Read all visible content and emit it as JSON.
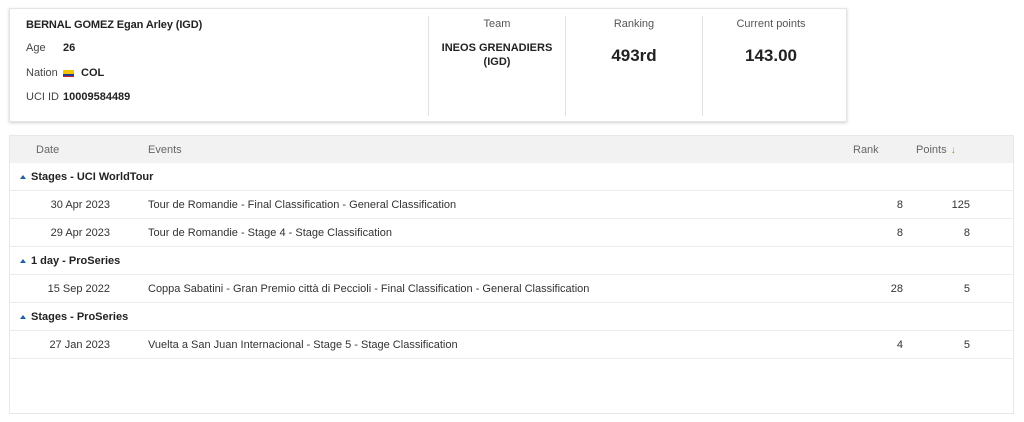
{
  "rider": {
    "name": "BERNAL GOMEZ Egan Arley (IGD)",
    "age_label": "Age",
    "age": "26",
    "nation_label": "Nation",
    "nation": "COL",
    "nation_flag_icon": "colombia-flag-icon",
    "uci_label": "UCI ID",
    "uci_id": "10009584489"
  },
  "summary": {
    "team_label": "Team",
    "team_line1": "INEOS GRENADIERS",
    "team_line2": "(IGD)",
    "ranking_label": "Ranking",
    "ranking": "493rd",
    "points_label": "Current points",
    "points": "143.00"
  },
  "table": {
    "headers": {
      "date": "Date",
      "events": "Events",
      "rank": "Rank",
      "points": "Points",
      "sort_icon": "sort-down-arrow-icon"
    },
    "groups": [
      {
        "label": "Stages - UCI WorldTour",
        "rows": [
          {
            "date": "30 Apr 2023",
            "event": "Tour de Romandie - Final Classification - General Classification",
            "rank": "8",
            "points": "125"
          },
          {
            "date": "29 Apr 2023",
            "event": "Tour de Romandie - Stage 4 - Stage Classification",
            "rank": "8",
            "points": "8"
          }
        ]
      },
      {
        "label": "1 day - ProSeries",
        "rows": [
          {
            "date": "15 Sep 2022",
            "event": "Coppa Sabatini - Gran Premio città di Peccioli - Final Classification - General Classification",
            "rank": "28",
            "points": "5"
          }
        ]
      },
      {
        "label": "Stages - ProSeries",
        "rows": [
          {
            "date": "27 Jan 2023",
            "event": "Vuelta a San Juan Internacional - Stage 5 - Stage Classification",
            "rank": "4",
            "points": "5"
          }
        ]
      }
    ]
  },
  "colors": {
    "accent_blue": "#1f5fa6",
    "sort_green": "#7aa61e",
    "header_bg": "#f2f2f2"
  }
}
